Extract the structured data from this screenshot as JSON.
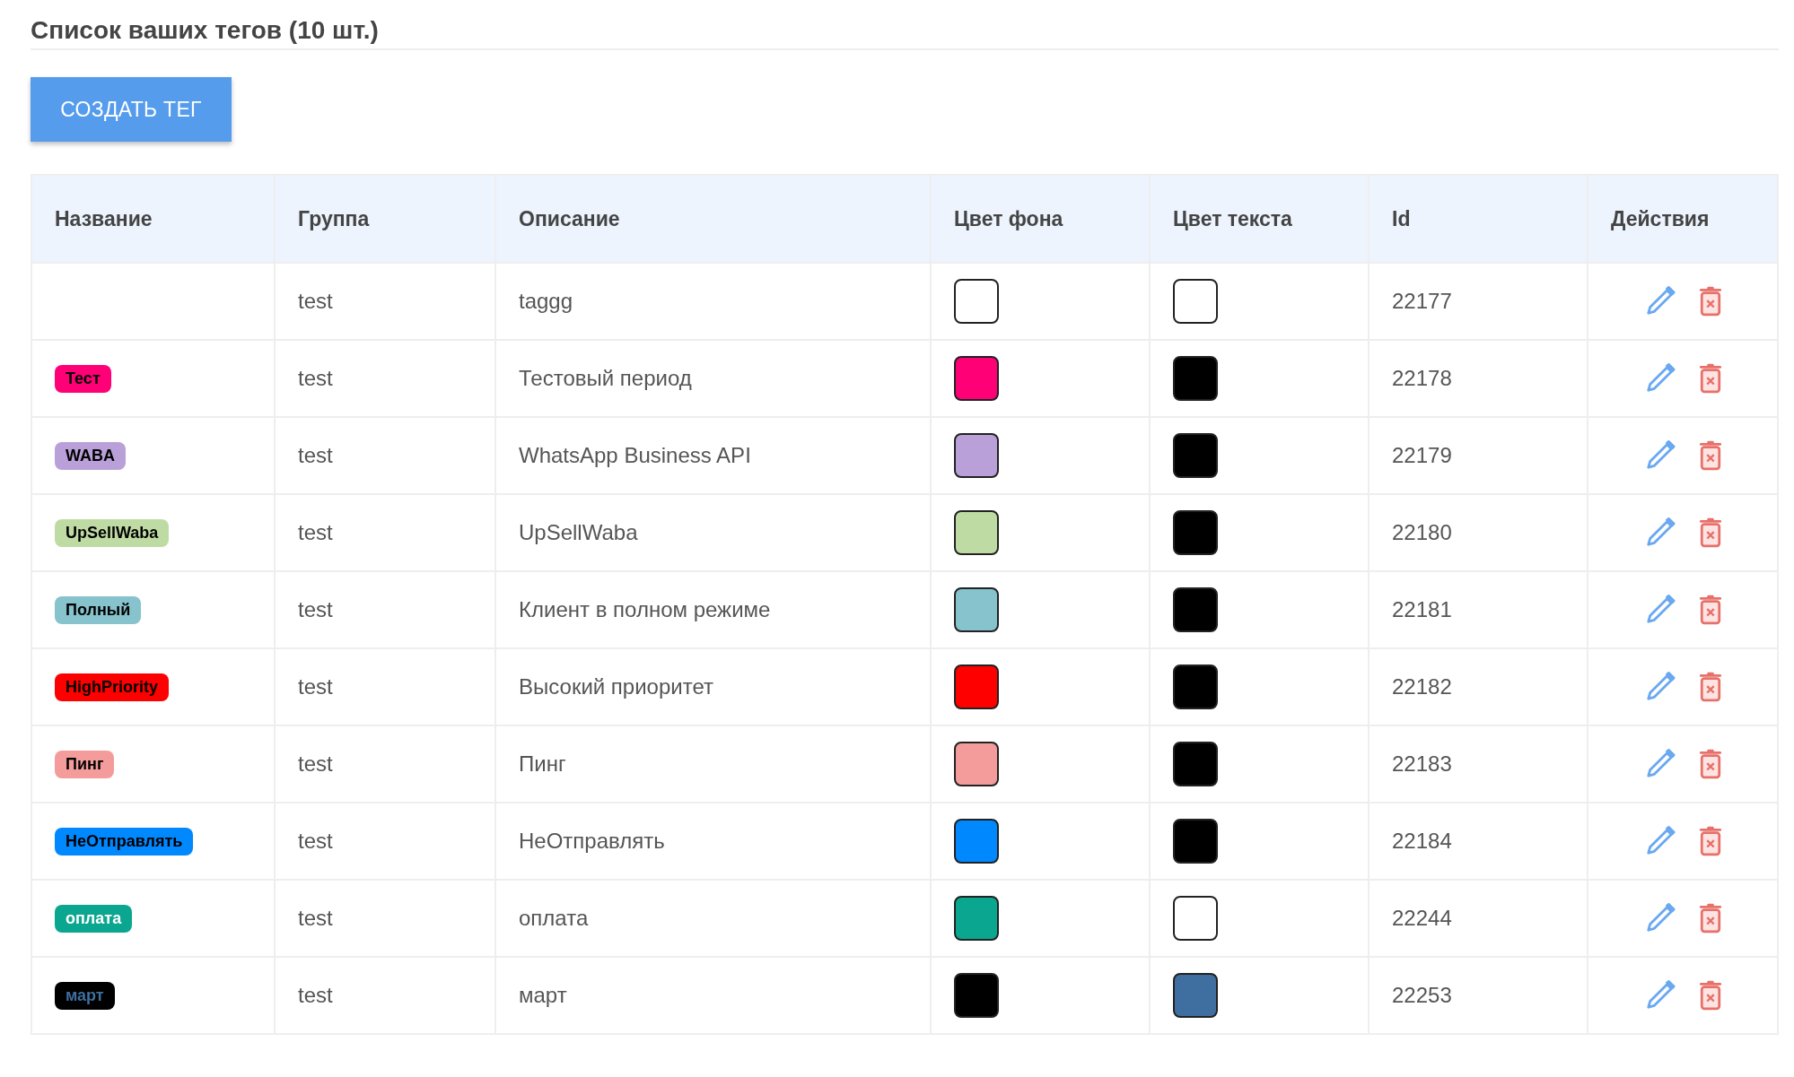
{
  "title": "Список ваших тегов (10 шт.)",
  "create_button": "СОЗДАТЬ ТЕГ",
  "table": {
    "columns": [
      "Название",
      "Группа",
      "Описание",
      "Цвет фона",
      "Цвет текста",
      "Id",
      "Действия"
    ],
    "rows": [
      {
        "tag": null,
        "group": "test",
        "description": "taggg",
        "background": {
          "color": "#ffffff"
        },
        "foreground": {
          "color": "#ffffff"
        },
        "id": "22177"
      },
      {
        "tag": "Тест",
        "group": "test",
        "description": "Тестовый период",
        "background": {
          "color": "#ff0077"
        },
        "foreground": {
          "color": "#000000"
        },
        "id": "22178"
      },
      {
        "tag": "WABA",
        "group": "test",
        "description": "WhatsApp Business API",
        "background": {
          "color": "#b9a0d9"
        },
        "foreground": {
          "color": "#000000"
        },
        "id": "22179"
      },
      {
        "tag": "UpSellWaba",
        "group": "test",
        "description": "UpSellWaba",
        "background": {
          "color": "#bfdba4"
        },
        "foreground": {
          "color": "#000000"
        },
        "id": "22180"
      },
      {
        "tag": "Полный",
        "group": "test",
        "description": "Клиент в полном режиме",
        "background": {
          "color": "#86c3cc"
        },
        "foreground": {
          "color": "#000000"
        },
        "id": "22181"
      },
      {
        "tag": "HighPriority",
        "group": "test",
        "description": "Высокий приоритет",
        "background": {
          "color": "#ff0000"
        },
        "foreground": {
          "color": "#000000"
        },
        "id": "22182"
      },
      {
        "tag": "Пинг",
        "group": "test",
        "description": "Пинг",
        "background": {
          "color": "#f49c9c"
        },
        "foreground": {
          "color": "#000000"
        },
        "id": "22183"
      },
      {
        "tag": "НеОтправлять",
        "group": "test",
        "description": "НеОтправлять",
        "background": {
          "color": "#0088ff"
        },
        "foreground": {
          "color": "#000000"
        },
        "id": "22184"
      },
      {
        "tag": "оплата",
        "group": "test",
        "description": "оплата",
        "background": {
          "color": "#0ba68f"
        },
        "foreground": {
          "color": "#ffffff"
        },
        "id": "22244"
      },
      {
        "tag": "март",
        "group": "test",
        "description": "март",
        "background": {
          "color": "#000000"
        },
        "foreground": {
          "color": "#3f6fa0"
        },
        "id": "22253"
      }
    ]
  }
}
